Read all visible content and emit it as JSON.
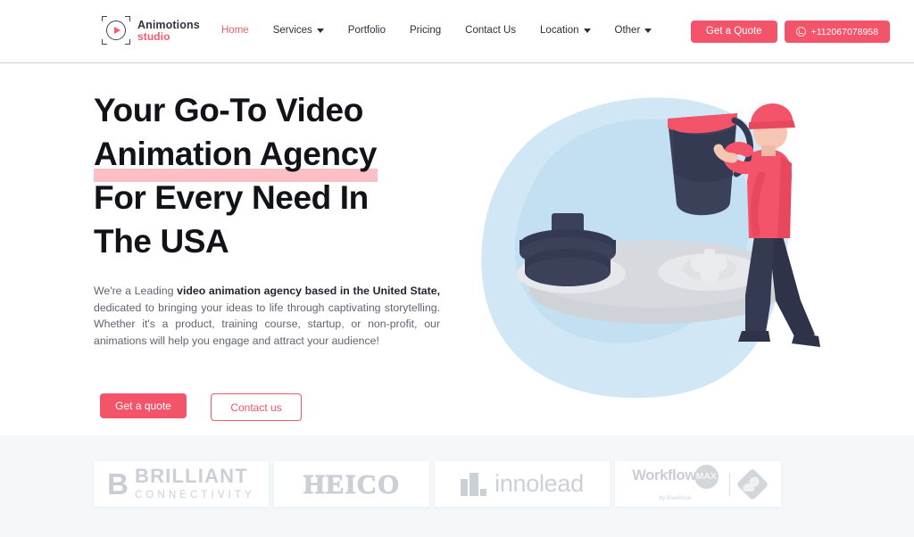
{
  "brand": {
    "name": "Animotions",
    "sub": "studio",
    "icon": "play-circle-logo-icon"
  },
  "nav": {
    "items": [
      {
        "label": "Home",
        "active": true,
        "dropdown": false
      },
      {
        "label": "Services",
        "active": false,
        "dropdown": true
      },
      {
        "label": "Portfolio",
        "active": false,
        "dropdown": false
      },
      {
        "label": "Pricing",
        "active": false,
        "dropdown": false
      },
      {
        "label": "Contact Us",
        "active": false,
        "dropdown": false
      },
      {
        "label": "Location",
        "active": false,
        "dropdown": true
      },
      {
        "label": "Other",
        "active": false,
        "dropdown": true
      }
    ]
  },
  "header": {
    "quote_label": "Get a Quote",
    "phone": "+112067078958",
    "phone_icon": "whatsapp-icon"
  },
  "hero": {
    "headline_line1": "Your Go-To Video",
    "headline_line2": "Animation Agency",
    "headline_line3": "For Every Need In",
    "headline_line4": "The USA",
    "lede_part1": "We're a Leading ",
    "lede_bold": "video animation agency based in the United State,",
    "lede_part2": " dedicated to bringing your ideas to life through captivating storytelling. Whether it's a product, training course, startup, or non-profit, our animations will help you engage and attract your audience!",
    "cta_primary": "Get a quote",
    "cta_secondary": "Contact us",
    "illustration": "person-carrying-bucket-illustration"
  },
  "logos": {
    "items": [
      {
        "name": "Brilliant Connectivity",
        "line1": "BRILLIANT",
        "line2": "CONNECTIVITY",
        "mark": "B"
      },
      {
        "name": "HEICO",
        "word": "HEICO"
      },
      {
        "name": "innolead",
        "word": "innolead"
      },
      {
        "name": "WorkflowMAX by BlueRock",
        "word": "Workflow",
        "badge": "MAX",
        "by": "by BlueRock"
      }
    ]
  },
  "colors": {
    "accent": "#f4546a",
    "highlight": "#fbbfc6",
    "band_bg": "#f4f8fb",
    "heading": "#111318",
    "body_text": "#5f6470",
    "illustration_blob": "#c4e2f2",
    "illustration_dark": "#333a52"
  }
}
